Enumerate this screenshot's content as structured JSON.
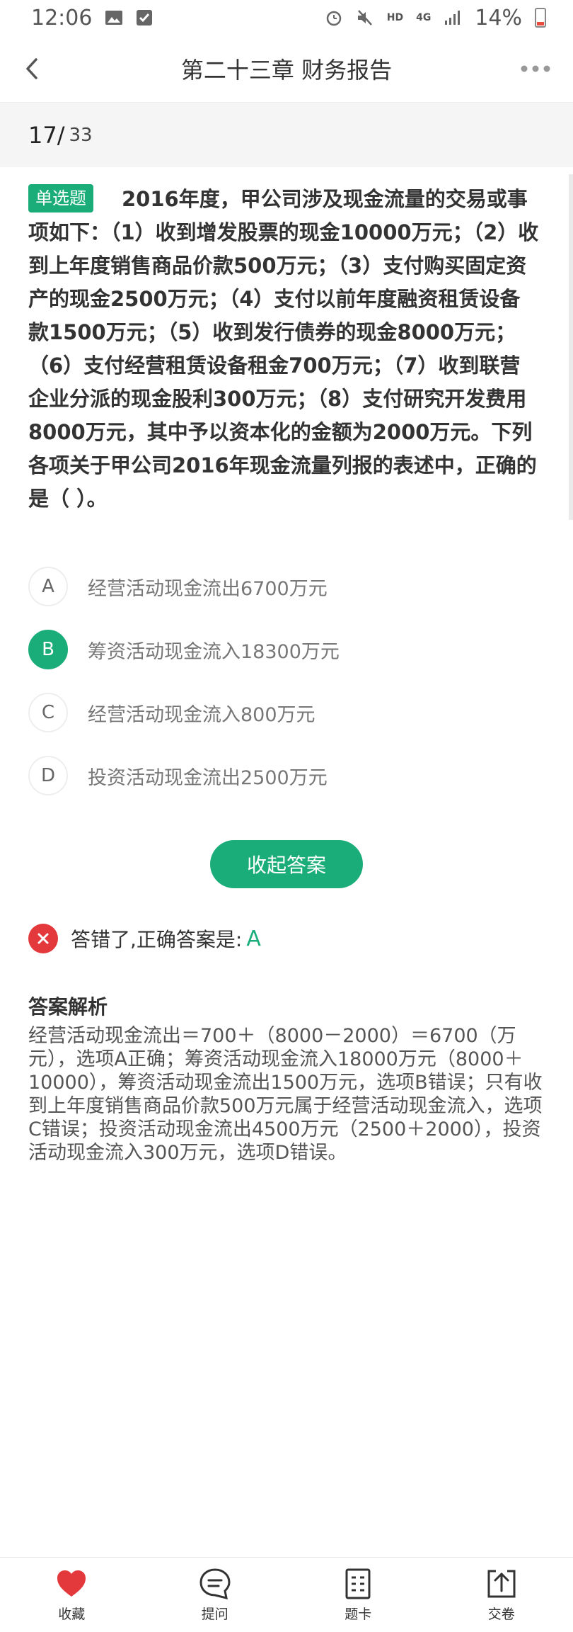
{
  "status_bar": {
    "time": "12:06",
    "network": "4G",
    "hd": "HD",
    "battery": "14%"
  },
  "header": {
    "title": "第二十三章 财务报告"
  },
  "progress": {
    "current": "17/",
    "total": "33"
  },
  "question": {
    "type_label": "单选题",
    "text": "2016年度，甲公司涉及现金流量的交易或事项如下：（1）收到增发股票的现金10000万元；（2）收到上年度销售商品价款500万元；（3）支付购买固定资产的现金2500万元；（4）支付以前年度融资租赁设备款1500万元；（5）收到发行债券的现金8000万元；（6）支付经营租赁设备租金700万元；（7）收到联营企业分派的现金股利300万元；（8）支付研究开发费用8000万元，其中予以资本化的金额为2000万元。下列各项关于甲公司2016年现金流量列报的表述中，正确的是（ ）。"
  },
  "options": [
    {
      "letter": "A",
      "text": "经营活动现金流出6700万元"
    },
    {
      "letter": "B",
      "text": "筹资活动现金流入18300万元"
    },
    {
      "letter": "C",
      "text": "经营活动现金流入800万元"
    },
    {
      "letter": "D",
      "text": "投资活动现金流出2500万元"
    }
  ],
  "collapse_button_label": "收起答案",
  "result": {
    "text": "答错了,正确答案是:",
    "correct": "A"
  },
  "analysis": {
    "title": "答案解析",
    "body": "经营活动现金流出＝700＋（8000－2000）＝6700（万元），选项A正确；筹资活动现金流入18000万元（8000＋10000），筹资活动现金流出1500万元，选项B错误；只有收到上年度销售商品价款500万元属于经营活动现金流入，选项C错误；投资活动现金流出4500万元（2500＋2000），投资活动现金流入300万元，选项D错误。"
  },
  "bottom_nav": [
    {
      "label": "收藏",
      "icon": "heart-icon"
    },
    {
      "label": "提问",
      "icon": "question-chat-icon"
    },
    {
      "label": "题卡",
      "icon": "answer-sheet-icon"
    },
    {
      "label": "交卷",
      "icon": "submit-icon"
    }
  ],
  "colors": {
    "accent": "#1aad7a",
    "error": "#e4393c"
  }
}
